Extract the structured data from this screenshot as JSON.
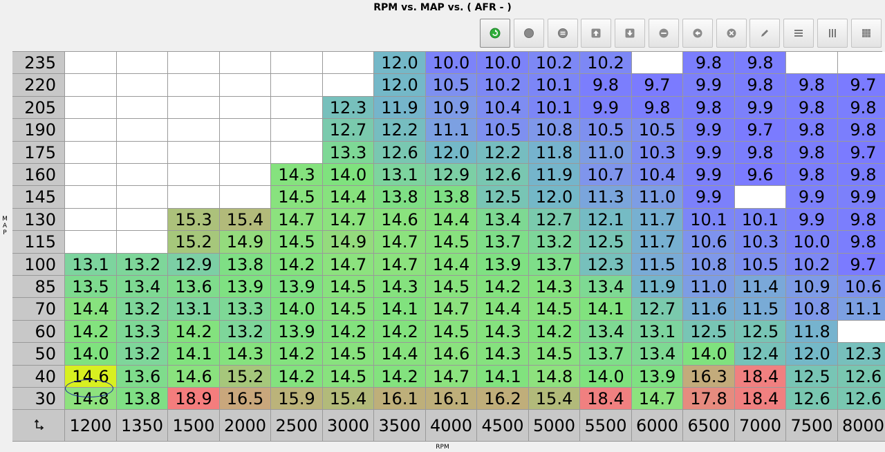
{
  "window": {
    "title": "RPM vs. MAP vs. ( AFR -   )",
    "y_axis_label": "M\nA\nP",
    "x_axis_label": "RPM"
  },
  "toolbar": {
    "buttons": [
      {
        "name": "refresh-button",
        "icon": "green-refresh-icon",
        "active": true
      },
      {
        "name": "dot-button",
        "icon": "filled-circle-icon",
        "active": false
      },
      {
        "name": "equals-button",
        "icon": "equals-circle-icon",
        "active": false
      },
      {
        "name": "up-button",
        "icon": "arrow-up-box-icon",
        "active": false
      },
      {
        "name": "down-button",
        "icon": "arrow-down-box-icon",
        "active": false
      },
      {
        "name": "minus-button",
        "icon": "minus-circle-icon",
        "active": false
      },
      {
        "name": "back-button",
        "icon": "arrow-left-circle-icon",
        "active": false
      },
      {
        "name": "clear-button",
        "icon": "x-circle-icon",
        "active": false
      },
      {
        "name": "edit-button",
        "icon": "pencil-icon",
        "active": false
      },
      {
        "name": "rows-button",
        "icon": "horizontal-lines-icon",
        "active": false
      },
      {
        "name": "columns-button",
        "icon": "vertical-lines-icon",
        "active": false
      },
      {
        "name": "grid-button",
        "icon": "grid-icon",
        "active": false
      }
    ]
  },
  "table": {
    "corner_icon": "axis-swap-icon",
    "map_values": [
      "235",
      "220",
      "205",
      "190",
      "175",
      "160",
      "145",
      "130",
      "115",
      "100",
      "85",
      "70",
      "60",
      "50",
      "40",
      "30"
    ],
    "rpm_values": [
      "1200",
      "1350",
      "1500",
      "2000",
      "2500",
      "3000",
      "3500",
      "4000",
      "4500",
      "5000",
      "5500",
      "6000",
      "6500",
      "7000",
      "7500",
      "8000"
    ],
    "rows": [
      [
        "",
        "",
        "",
        "",
        "",
        "",
        "12.0",
        "10.0",
        "10.0",
        "10.2",
        "10.2",
        "",
        "9.8",
        "9.8",
        "",
        ""
      ],
      [
        "",
        "",
        "",
        "",
        "",
        "",
        "12.0",
        "10.5",
        "10.2",
        "10.1",
        "9.8",
        "9.7",
        "9.9",
        "9.8",
        "9.8",
        "9.7"
      ],
      [
        "",
        "",
        "",
        "",
        "",
        "12.3",
        "11.9",
        "10.9",
        "10.4",
        "10.1",
        "9.9",
        "9.8",
        "9.8",
        "9.9",
        "9.8",
        "9.8"
      ],
      [
        "",
        "",
        "",
        "",
        "",
        "12.7",
        "12.2",
        "11.1",
        "10.5",
        "10.8",
        "10.5",
        "10.5",
        "9.9",
        "9.7",
        "9.8",
        "9.8"
      ],
      [
        "",
        "",
        "",
        "",
        "",
        "13.3",
        "12.6",
        "12.0",
        "12.2",
        "11.8",
        "11.0",
        "10.3",
        "9.9",
        "9.8",
        "9.8",
        "9.7"
      ],
      [
        "",
        "",
        "",
        "",
        "14.3",
        "14.0",
        "13.1",
        "12.9",
        "12.6",
        "11.9",
        "10.7",
        "10.4",
        "9.9",
        "9.6",
        "9.8",
        "9.8"
      ],
      [
        "",
        "",
        "",
        "",
        "14.5",
        "14.4",
        "13.8",
        "13.8",
        "12.5",
        "12.0",
        "11.3",
        "11.0",
        "9.9",
        "",
        "9.9",
        "9.9"
      ],
      [
        "",
        "",
        "15.3",
        "15.4",
        "14.7",
        "14.7",
        "14.6",
        "14.4",
        "13.4",
        "12.7",
        "12.1",
        "11.7",
        "10.1",
        "10.1",
        "9.9",
        "9.8"
      ],
      [
        "",
        "",
        "15.2",
        "14.9",
        "14.5",
        "14.9",
        "14.7",
        "14.5",
        "13.7",
        "13.2",
        "12.5",
        "11.7",
        "10.6",
        "10.3",
        "10.0",
        "9.8"
      ],
      [
        "13.1",
        "13.2",
        "12.9",
        "13.8",
        "14.2",
        "14.7",
        "14.7",
        "14.4",
        "13.9",
        "13.7",
        "12.3",
        "11.5",
        "10.8",
        "10.5",
        "10.2",
        "9.7"
      ],
      [
        "13.5",
        "13.4",
        "13.6",
        "13.9",
        "13.9",
        "14.5",
        "14.3",
        "14.5",
        "14.2",
        "14.3",
        "13.4",
        "11.9",
        "11.0",
        "11.4",
        "10.9",
        "10.6"
      ],
      [
        "14.4",
        "13.2",
        "13.1",
        "13.3",
        "14.0",
        "14.5",
        "14.1",
        "14.7",
        "14.4",
        "14.5",
        "14.1",
        "12.7",
        "11.6",
        "11.5",
        "10.8",
        "11.1"
      ],
      [
        "14.2",
        "13.3",
        "14.2",
        "13.2",
        "13.9",
        "14.2",
        "14.2",
        "14.5",
        "14.3",
        "14.2",
        "13.4",
        "13.1",
        "12.5",
        "12.5",
        "11.8",
        ""
      ],
      [
        "14.0",
        "13.2",
        "14.1",
        "14.3",
        "14.2",
        "14.5",
        "14.4",
        "14.6",
        "14.3",
        "14.5",
        "13.7",
        "13.4",
        "14.0",
        "12.4",
        "12.0",
        "12.3"
      ],
      [
        "14.6",
        "13.6",
        "14.6",
        "15.2",
        "14.2",
        "14.5",
        "14.2",
        "14.7",
        "14.1",
        "14.8",
        "14.0",
        "13.9",
        "16.3",
        "18.4",
        "12.5",
        "12.6"
      ],
      [
        "14.8",
        "13.8",
        "18.9",
        "16.5",
        "15.9",
        "15.4",
        "16.1",
        "16.1",
        "16.2",
        "15.4",
        "18.4",
        "14.7",
        "17.8",
        "18.4",
        "12.6",
        "12.6"
      ]
    ],
    "selected_cell": {
      "map": "40",
      "rpm": "1200"
    },
    "color_scale": {
      "stops": [
        {
          "afr": 9.7,
          "color": "#7b7bff"
        },
        {
          "afr": 10.8,
          "color": "#7f98ea"
        },
        {
          "afr": 12.0,
          "color": "#74b8c8"
        },
        {
          "afr": 13.2,
          "color": "#7ed69a"
        },
        {
          "afr": 14.0,
          "color": "#7fe27e"
        },
        {
          "afr": 14.8,
          "color": "#8ee27e"
        },
        {
          "afr": 15.4,
          "color": "#b2ba7a"
        },
        {
          "afr": 16.2,
          "color": "#c0ae7a"
        },
        {
          "afr": 17.0,
          "color": "#d89a7e"
        },
        {
          "afr": 18.4,
          "color": "#f08080"
        },
        {
          "afr": 19.0,
          "color": "#f57c7c"
        }
      ],
      "selected_color": "#d8f020",
      "empty_color": "#ffffff",
      "header_color": "#c8c8c8"
    }
  }
}
